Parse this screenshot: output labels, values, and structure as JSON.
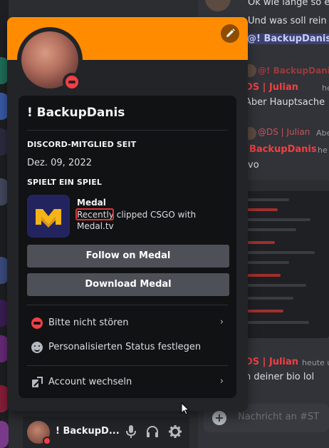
{
  "colors": {
    "banner": "#ff8c00",
    "dnd": "#f23f43",
    "mention_red": "#f23f42",
    "highlight_box": "#e0313a",
    "button": "#4e5058"
  },
  "chat": {
    "lines": [
      "Ok wie lange so en",
      "Und was soll rein",
      "@! BackupDanis",
      "@! BackupDanis",
      "DS | Julian",
      "heute u",
      "Aber Hauptsache",
      "@DS | Julian",
      "Abe",
      "BackupDanis",
      "he",
      "vo",
      "DS | Julian",
      "heute u",
      "n deiner bio lol"
    ],
    "composer_placeholder": "Nachricht an #ST"
  },
  "popout": {
    "edit_icon": "pencil-icon",
    "status": "dnd",
    "username": "! BackupDanis",
    "member_since_heading": "DISCORD-MITGLIED SEIT",
    "member_since": "Dez. 09, 2022",
    "activity_heading": "SPIELT EIN SPIEL",
    "game": {
      "name": "Medal",
      "detail_highlight": "Recently",
      "detail_rest": " clipped CSGO with Medal.tv",
      "icon": "medal-logo-icon"
    },
    "buttons": {
      "follow": "Follow on Medal",
      "download": "Download Medal"
    },
    "menu": {
      "dnd": "Bitte nicht stören",
      "custom_status": "Personalisierten Status festlegen",
      "switch_account": "Account wechseln"
    }
  },
  "userbar": {
    "name": "! BackupD...",
    "mic_icon": "microphone-icon",
    "headset_icon": "headphones-icon",
    "settings_icon": "gear-icon"
  }
}
